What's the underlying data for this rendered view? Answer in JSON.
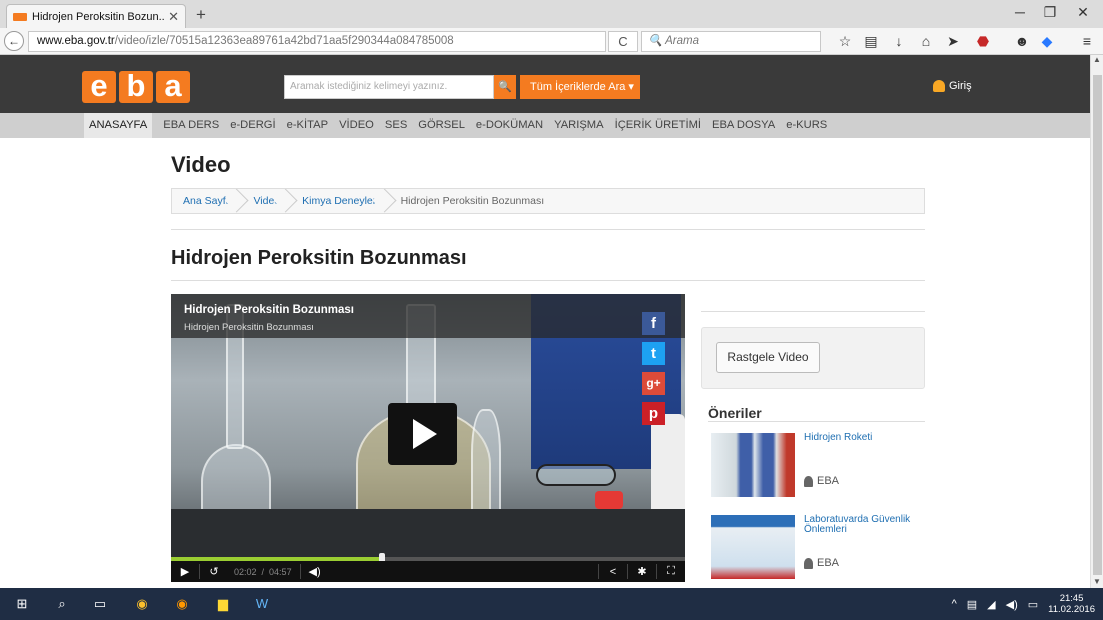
{
  "browser": {
    "tab_title": "Hidrojen Peroksitin Bozun...",
    "url_domain": "www.eba.gov.tr",
    "url_path": "/video/izle/70515a12363ea89761a42bd71aa5f290344a084785008",
    "search_placeholder": "Arama"
  },
  "site": {
    "logo": [
      "e",
      "b",
      "a"
    ],
    "search_placeholder": "Aramak istediğiniz kelimeyi yazınız.",
    "scope_button": "Tüm İçeriklerde Ara",
    "login": "Giriş"
  },
  "menu": [
    "ANASAYFA",
    "EBA DERS",
    "e-DERGİ",
    "e-KİTAP",
    "VİDEO",
    "SES",
    "GÖRSEL",
    "e-DOKÜMAN",
    "YARIŞMA",
    "İÇERİK ÜRETİMİ",
    "EBA DOSYA",
    "e-KURS"
  ],
  "page": {
    "section_title": "Video",
    "breadcrumb": [
      "Ana Sayfa",
      "Video",
      "Kimya Deneyleri",
      "Hidrojen Peroksitin Bozunması"
    ],
    "heading": "Hidrojen Peroksitin Bozunması"
  },
  "player": {
    "title": "Hidrojen Peroksitin Bozunması",
    "subtitle": "Hidrojen Peroksitin Bozunması",
    "current_time": "02:02",
    "separator": "/",
    "duration": "04:57",
    "progress": 0.41
  },
  "social": [
    "f",
    "t",
    "g+",
    "p"
  ],
  "sidebar": {
    "random_button": "Rastgele Video",
    "recommendations_title": "Öneriler",
    "items": [
      {
        "title": "Hidrojen Roketi",
        "author": "EBA"
      },
      {
        "title": "Laboratuvarda Güvenlik Önlemleri",
        "author": "EBA"
      }
    ]
  },
  "taskbar": {
    "time": "21:45",
    "date": "11.02.2016"
  },
  "colors": {
    "brand_orange": "#f47b20",
    "header_dark": "#3a3a3a",
    "link_blue": "#1f6fb2",
    "facebook": "#3b5998",
    "twitter": "#1da1f2",
    "googleplus": "#dd4b39",
    "pinterest": "#cb2027"
  }
}
